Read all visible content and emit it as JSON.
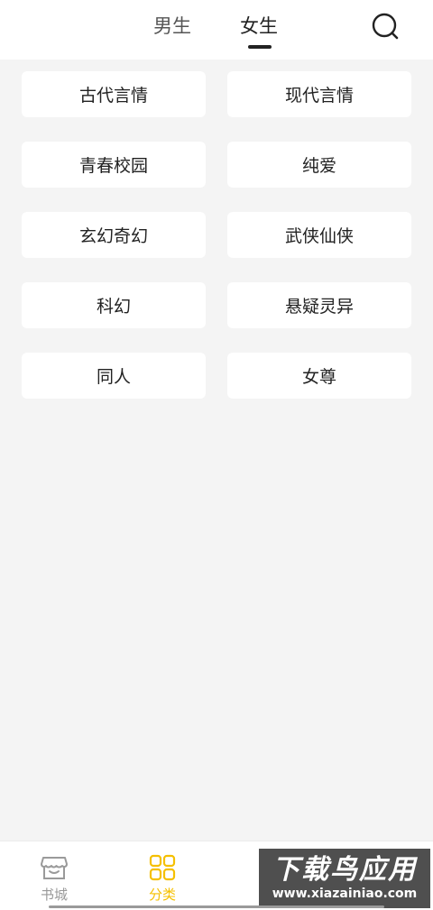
{
  "header": {
    "tabs": [
      {
        "label": "男生",
        "active": false
      },
      {
        "label": "女生",
        "active": true
      }
    ],
    "search_icon": "search-icon"
  },
  "categories": [
    {
      "label": "古代言情"
    },
    {
      "label": "现代言情"
    },
    {
      "label": "青春校园"
    },
    {
      "label": "纯爱"
    },
    {
      "label": "玄幻奇幻"
    },
    {
      "label": "武侠仙侠"
    },
    {
      "label": "科幻"
    },
    {
      "label": "悬疑灵异"
    },
    {
      "label": "同人"
    },
    {
      "label": "女尊"
    }
  ],
  "bottom_nav": {
    "items": [
      {
        "label": "书城",
        "icon": "bookstore-icon",
        "active": false
      },
      {
        "label": "分类",
        "icon": "category-grid-icon",
        "active": true
      }
    ]
  },
  "watermark": {
    "title": "下载鸟应用",
    "url": "www.xiazainiao.com"
  },
  "colors": {
    "accent": "#f5c000",
    "background": "#f4f4f4",
    "card": "#ffffff",
    "text": "#222222",
    "inactive": "#999999"
  }
}
